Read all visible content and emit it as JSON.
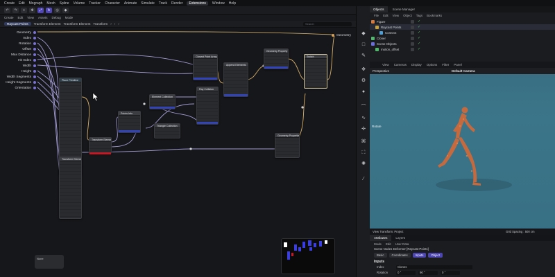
{
  "menubar": [
    "Create",
    "Edit",
    "Mograph",
    "Mesh",
    "Spline",
    "Volume",
    "Tracker",
    "Character",
    "Animate",
    "Simulate",
    "Track",
    "Render",
    "Extensions",
    "Window",
    "Help"
  ],
  "menubar_active": "Extensions",
  "toolbar_icons": [
    "undo-icon",
    "redo-icon",
    "select-icon",
    "move-icon",
    "scale-icon",
    "rotate-icon",
    "live-select-icon",
    "cube-icon"
  ],
  "node_editor": {
    "menu": [
      "Create",
      "Edit",
      "View",
      "Assets",
      "Debug",
      "Mode"
    ],
    "breadcrumb": [
      "Raycast Points",
      "Transform Element",
      "Transform Element",
      "Transform"
    ],
    "search_placeholder": "Search",
    "inputs": [
      "Geometry",
      "Index",
      "Rotation",
      "Offset",
      "Max Distance",
      "Hit Index",
      "Width",
      "Height",
      "Width Segments",
      "Height Segments",
      "Orientation"
    ],
    "output": "Geometry",
    "nodes": [
      {
        "id": "plane",
        "title": "Plane Primitive"
      },
      {
        "id": "transform_el",
        "title": "Transform Element"
      },
      {
        "id": "transform_el2",
        "title": "Transform Element"
      },
      {
        "id": "points_info",
        "title": "Points Info"
      },
      {
        "id": "element_collection",
        "title": "Element Collection"
      },
      {
        "id": "triangle_collection",
        "title": "Triangle Collection"
      },
      {
        "id": "closest_point",
        "title": "Closest Point Array"
      },
      {
        "id": "ray_collision",
        "title": "Ray Collision"
      },
      {
        "id": "append_elements",
        "title": "Append Elements"
      },
      {
        "id": "geometry_property_set",
        "title": "Geometry Property Set"
      },
      {
        "id": "switch",
        "title": "Switch"
      },
      {
        "id": "geometry_properties",
        "title": "Geometry Properties"
      }
    ],
    "note": "None"
  },
  "objects_panel": {
    "tabs": [
      "Objects",
      "Scene Manager"
    ],
    "menu": [
      "File",
      "Edit",
      "View",
      "Object",
      "Tags",
      "Bookmarks"
    ],
    "rows": [
      {
        "name": "Figure",
        "color": "#d77a3c"
      },
      {
        "name": "Raycast Points",
        "color": "#c9a33d"
      },
      {
        "name": "Connect",
        "color": "#4e9fd6"
      },
      {
        "name": "Cloner",
        "color": "#4fb86a"
      },
      {
        "name": "Scene Objects",
        "color": "#6b6ee0"
      },
      {
        "name": "motion_offset",
        "color": "#4fb86a"
      }
    ]
  },
  "viewport": {
    "menu": [
      "View",
      "Cameras",
      "Display",
      "Options",
      "Filter",
      "Panel"
    ],
    "mode": "Perspective",
    "camera": "Default Camera",
    "hud_label": "Rotate",
    "status_left": "View Transform: Project",
    "status_right": "Grid Spacing : 500 cm"
  },
  "attributes": {
    "tabs": [
      "Attributes",
      "Layers"
    ],
    "menu": [
      "Mode",
      "Edit",
      "User Data"
    ],
    "object_title": "Scene Nodes Deformer [Raycast Points]",
    "subtabs": [
      "Basic",
      "Coordinates",
      "Inputs",
      "Object"
    ],
    "active_subtabs": [
      "Inputs",
      "Object"
    ],
    "section": "Inputs",
    "fields": [
      {
        "label": "Index",
        "value": "Clones"
      },
      {
        "label": "Rotation",
        "value": "0 °"
      },
      {
        "label": "Rotation_b",
        "value": "90 °"
      },
      {
        "label": "Rotation_c",
        "value": "0 °"
      }
    ]
  },
  "colors": {
    "accent": "#5146b6",
    "node_blue": "#3243b8",
    "node_red": "#c21a27",
    "viewport_bg": "#3a6e82",
    "figure": "#c46a3e"
  }
}
